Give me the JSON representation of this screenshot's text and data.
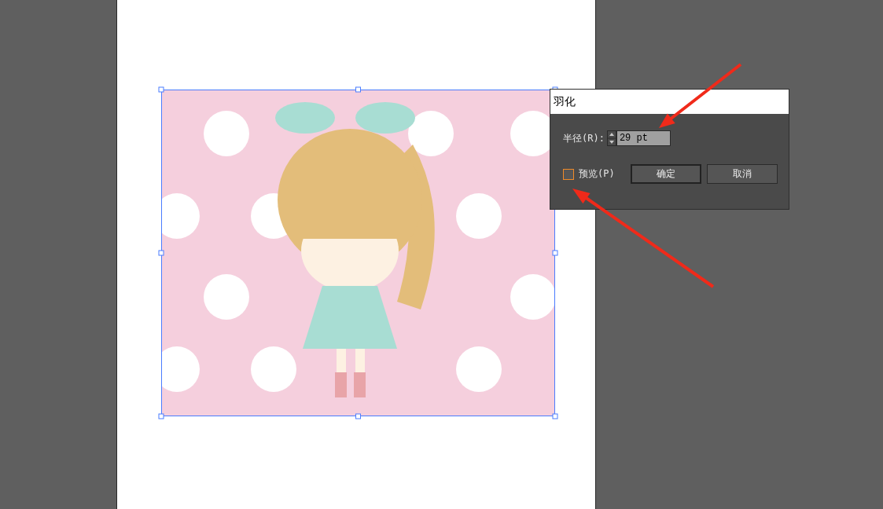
{
  "dialog": {
    "title": "羽化",
    "radius": {
      "label": "半径(R):",
      "value": "29 pt"
    },
    "preview": {
      "label": "预览(P)",
      "checked": false
    },
    "buttons": [
      {
        "label": "确定",
        "default": true
      },
      {
        "label": "取消",
        "default": false
      }
    ]
  }
}
